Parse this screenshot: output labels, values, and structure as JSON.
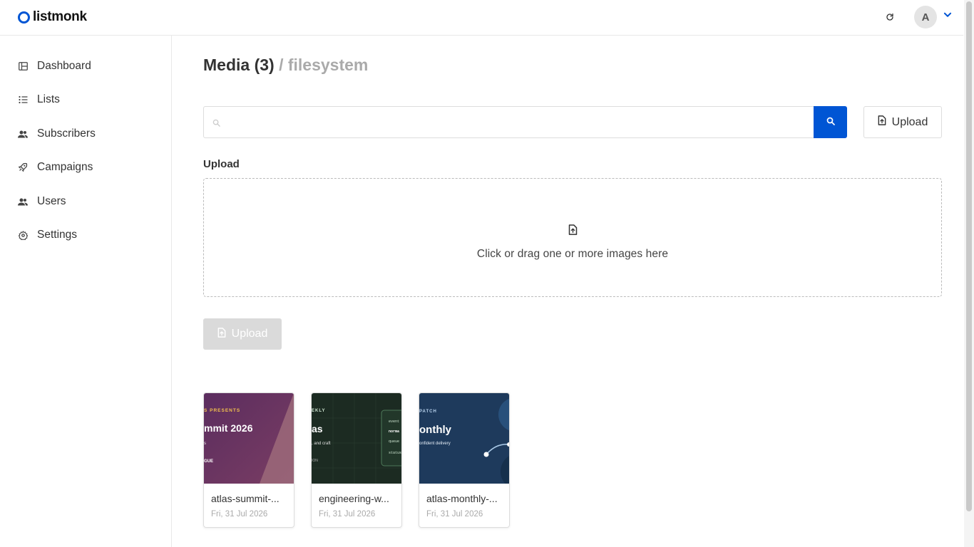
{
  "app": {
    "name": "listmonk",
    "accent": "#0055d4"
  },
  "header": {
    "avatar_initial": "A"
  },
  "sidebar": {
    "items": [
      {
        "label": "Dashboard",
        "icon": "dashboard-icon"
      },
      {
        "label": "Lists",
        "icon": "list-icon"
      },
      {
        "label": "Subscribers",
        "icon": "users-icon"
      },
      {
        "label": "Campaigns",
        "icon": "rocket-icon"
      },
      {
        "label": "Users",
        "icon": "users-icon"
      },
      {
        "label": "Settings",
        "icon": "gear-icon"
      }
    ]
  },
  "page": {
    "title": "Media (3)",
    "subtitle": "/ filesystem"
  },
  "search": {
    "value": "",
    "placeholder": ""
  },
  "toolbar": {
    "upload_label": "Upload"
  },
  "upload_section": {
    "label": "Upload",
    "dropzone_text": "Click or drag one or more images here",
    "submit_label": "Upload"
  },
  "media": [
    {
      "name": "atlas-summit-...",
      "date": "Fri, 31 Jul 2026",
      "thumb_lines": [
        "S PRESENTS",
        "mmit 2026",
        "s",
        "GUE"
      ]
    },
    {
      "name": "engineering-w...",
      "date": "Fri, 31 Jul 2026",
      "thumb_lines": [
        "EKLY",
        "as",
        ", and craft",
        "ION",
        "event",
        "norma",
        "queue",
        "status"
      ]
    },
    {
      "name": "atlas-monthly-...",
      "date": "Fri, 31 Jul 2026",
      "thumb_lines": [
        "PATCH",
        "onthly",
        "onfident delivery"
      ]
    }
  ]
}
